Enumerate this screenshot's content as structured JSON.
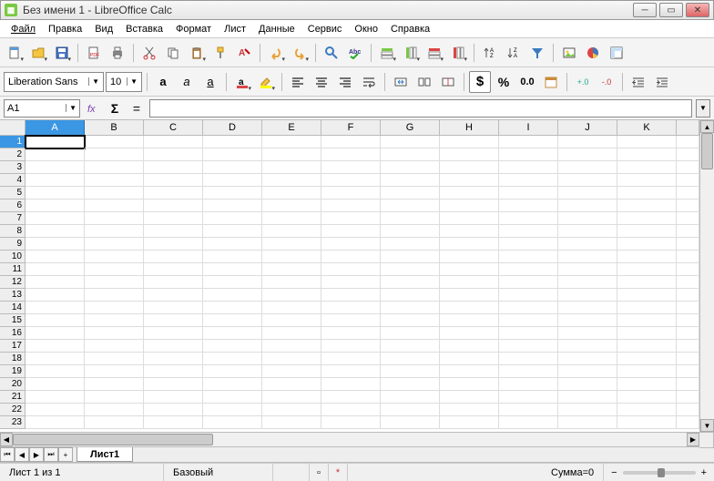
{
  "title": "Без имени 1 - LibreOffice Calc",
  "menu": {
    "file": "Файл",
    "edit": "Правка",
    "view": "Вид",
    "insert": "Вставка",
    "format": "Формат",
    "sheet": "Лист",
    "data": "Данные",
    "tools": "Сервис",
    "window": "Окно",
    "help": "Справка"
  },
  "font": {
    "name": "Liberation Sans",
    "size": "10"
  },
  "currency_label": "$",
  "percent_label": "%",
  "number_label": "0.0",
  "decimal_label": "0̲0",
  "decimal_label2": ".0̲0",
  "bold": "a",
  "italic": "a",
  "underline": "a̲",
  "namebox": "A1",
  "columns": [
    "A",
    "B",
    "C",
    "D",
    "E",
    "F",
    "G",
    "H",
    "I",
    "J",
    "K"
  ],
  "active_col": "A",
  "rows": [
    "1",
    "2",
    "3",
    "4",
    "5",
    "6",
    "7",
    "8",
    "9",
    "10",
    "11",
    "12",
    "13",
    "14",
    "15",
    "16",
    "17",
    "18",
    "19",
    "20",
    "21",
    "22",
    "23"
  ],
  "active_row": "1",
  "sheet_tab": "Лист1",
  "status": {
    "sheet": "Лист 1 из 1",
    "style": "Базовый",
    "sum": "Сумма=0",
    "zoom_minus": "−",
    "zoom_plus": "+"
  }
}
